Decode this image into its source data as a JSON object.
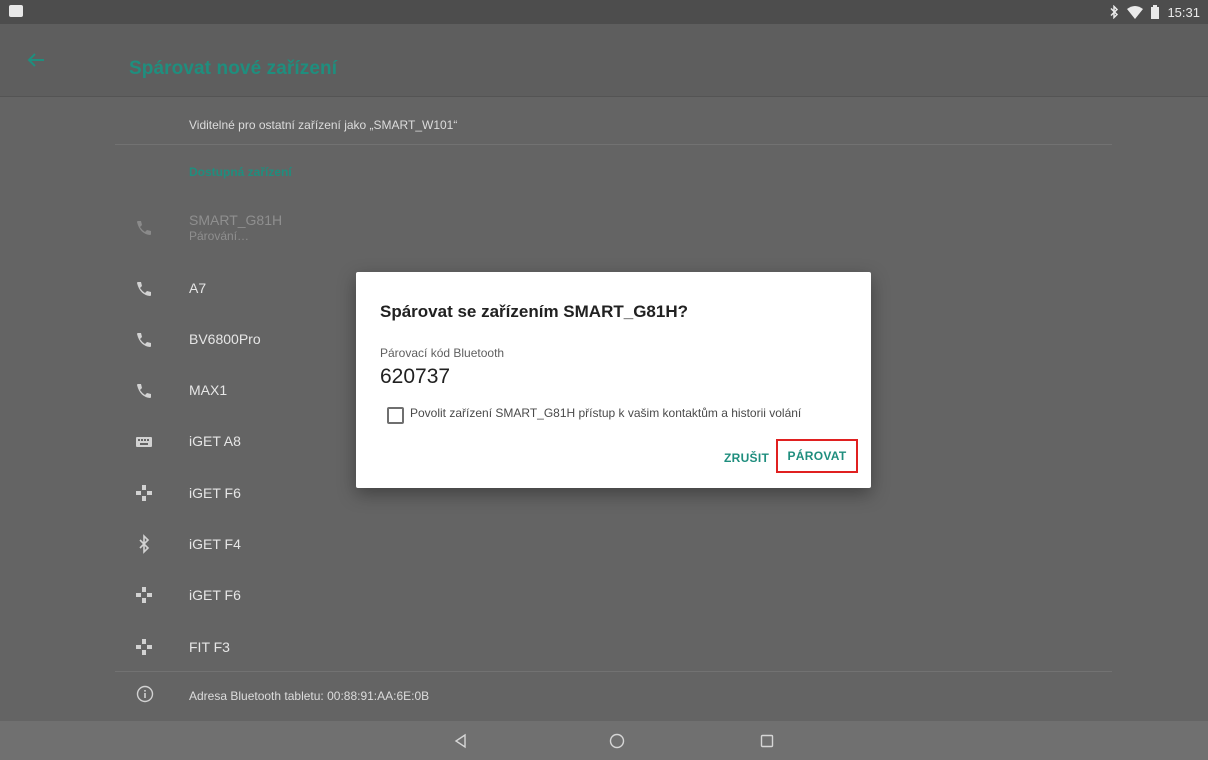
{
  "status_bar": {
    "time": "15:31"
  },
  "toolbar": {
    "title": "Spárovat nové zařízení"
  },
  "visibility_text": "Viditelné pro ostatní zařízení jako „SMART_W101“",
  "section": {
    "available_header": "Dostupná zařízení"
  },
  "devices": [
    {
      "name": "SMART_G81H",
      "subtitle": "Párování…",
      "icon": "phone-icon",
      "dimmed": true
    },
    {
      "name": "A7",
      "icon": "phone-icon"
    },
    {
      "name": "BV6800Pro",
      "icon": "phone-icon"
    },
    {
      "name": "MAX1",
      "icon": "phone-icon"
    },
    {
      "name": "iGET A8",
      "icon": "keyboard-icon"
    },
    {
      "name": "iGET F6",
      "icon": "gamepad-icon"
    },
    {
      "name": "iGET F4",
      "icon": "bluetooth-icon"
    },
    {
      "name": "iGET F6",
      "icon": "gamepad-icon"
    },
    {
      "name": "FIT F3",
      "icon": "gamepad-icon"
    }
  ],
  "address_text": "Adresa Bluetooth tabletu: 00:88:91:AA:6E:0B",
  "dialog": {
    "title": "Spárovat se zařízením SMART_G81H?",
    "code_label": "Párovací kód Bluetooth",
    "code": "620737",
    "checkbox_label": "Povolit zařízení SMART_G81H přístup k vašim kontaktům a historii volání",
    "checkbox_checked": false,
    "cancel_label": "ZRUŠIT",
    "pair_label": "PÁROVAT"
  },
  "colors": {
    "accent": "#1f8e7e",
    "highlight": "#e02020"
  }
}
